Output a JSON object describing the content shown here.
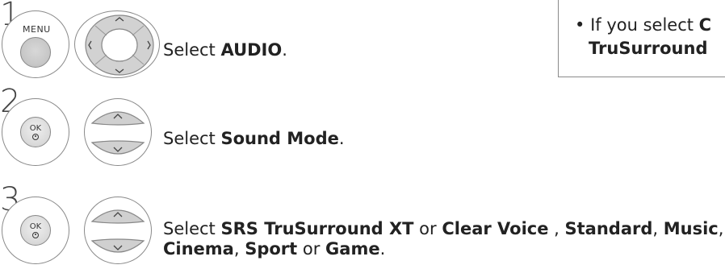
{
  "steps": [
    {
      "number": "1",
      "button_label": "MENU",
      "text_prefix": "Select ",
      "text_bold": "AUDIO",
      "text_suffix": "."
    },
    {
      "number": "2",
      "button_label": "OK",
      "text_prefix": "Select ",
      "text_bold": "Sound Mode",
      "text_suffix": "."
    },
    {
      "number": "3",
      "button_label": "OK",
      "line1": [
        {
          "t": "Select ",
          "b": false
        },
        {
          "t": "SRS TruSurround XT",
          "b": true
        },
        {
          "t": " or ",
          "b": false
        },
        {
          "t": "Clear Voice",
          "b": true
        },
        {
          "t": " , ",
          "b": false
        },
        {
          "t": "Standard",
          "b": true
        },
        {
          "t": ", ",
          "b": false
        },
        {
          "t": "Music",
          "b": true
        },
        {
          "t": ",",
          "b": false
        }
      ],
      "line2": [
        {
          "t": "Cinema",
          "b": true
        },
        {
          "t": ", ",
          "b": false
        },
        {
          "t": "Sport",
          "b": true
        },
        {
          "t": " or ",
          "b": false
        },
        {
          "t": "Game",
          "b": true
        },
        {
          "t": ".",
          "b": false
        }
      ]
    }
  ],
  "note": {
    "bullet": "•",
    "line1_prefix": "If you select ",
    "line1_bold": "C",
    "line2_bold": "TruSurround"
  }
}
